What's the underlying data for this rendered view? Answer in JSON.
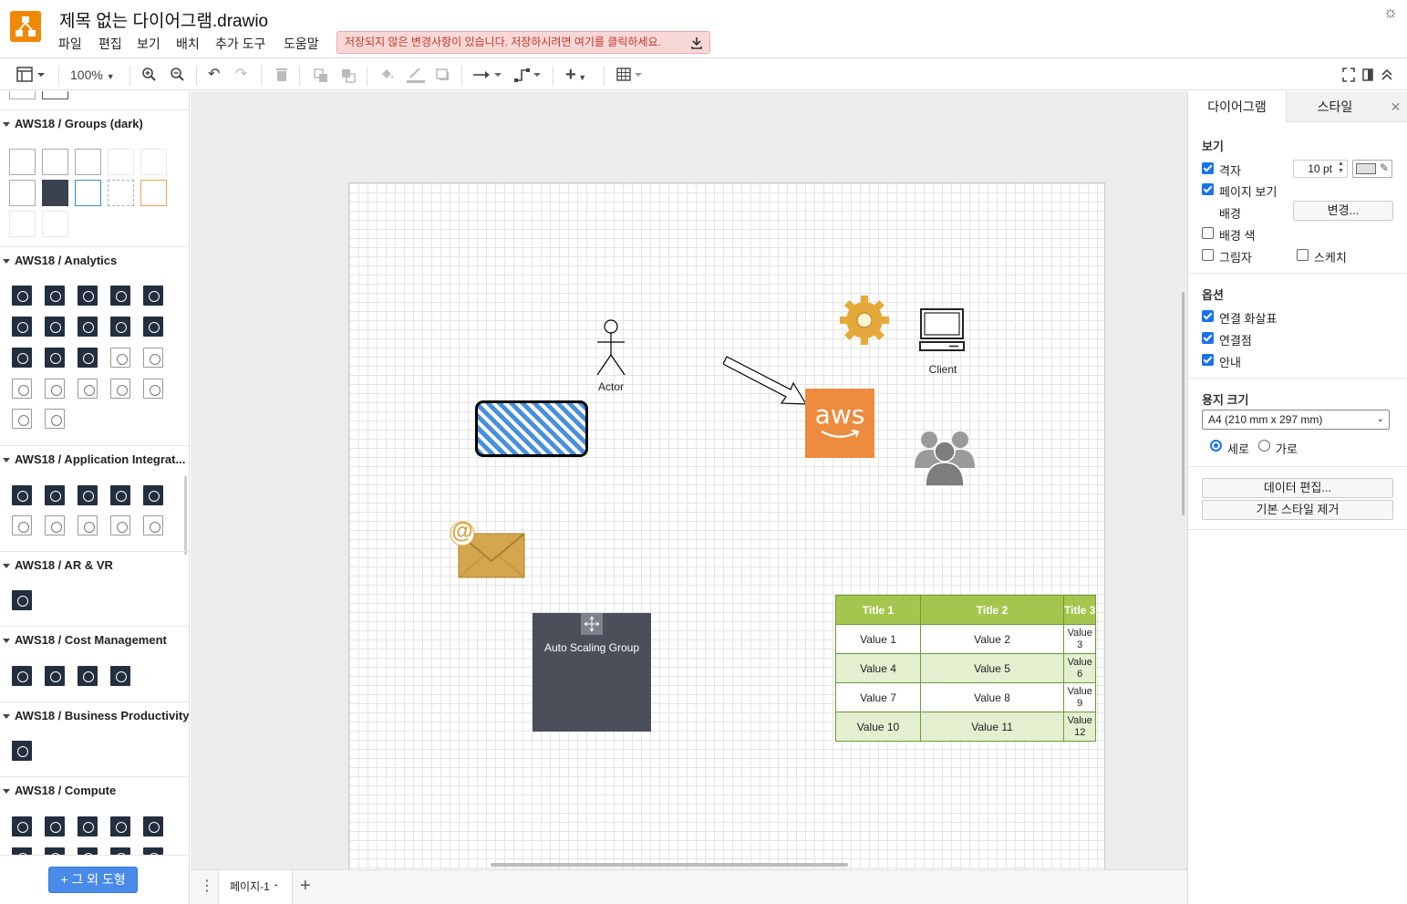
{
  "header": {
    "title": "제목 없는 다이어그램.drawio",
    "menu": [
      "파일",
      "편집",
      "보기",
      "배치",
      "추가 도구",
      "도움말"
    ],
    "unsaved_notice": "저장되지 않은 변경사항이 있습니다. 저장하시려면 여기를 클릭하세요."
  },
  "toolbar": {
    "zoom": "100%"
  },
  "sidebar": {
    "sections": [
      "AWS18 / Groups (dark)",
      "AWS18 / Analytics",
      "AWS18 / Application Integrat...",
      "AWS18 / AR & VR",
      "AWS18 / Cost Management",
      "AWS18 / Business Productivity",
      "AWS18 / Compute"
    ],
    "more_shapes": "+ 그 외 도형"
  },
  "canvas": {
    "actor_label": "Actor",
    "client_label": "Client",
    "aws_logo_text": "aws",
    "asg_label": "Auto Scaling Group",
    "table": {
      "headers": [
        "Title 1",
        "Title 2",
        "Title 3"
      ],
      "rows": [
        [
          "Value 1",
          "Value 2",
          "Value 3"
        ],
        [
          "Value 4",
          "Value 5",
          "Value 6"
        ],
        [
          "Value 7",
          "Value 8",
          "Value 9"
        ],
        [
          "Value 10",
          "Value 11",
          "Value 12"
        ]
      ],
      "header_color": "#a5c64e",
      "alt_row_color": "#e4efd0"
    },
    "email_glyph": "@"
  },
  "pages": {
    "current": "페이지-1"
  },
  "format_panel": {
    "tabs": [
      "다이어그램",
      "스타일"
    ],
    "view_section": "보기",
    "grid": {
      "label": "격자",
      "checked": true,
      "size": "10 pt"
    },
    "page_view": {
      "label": "페이지 보기",
      "checked": true
    },
    "background": {
      "label": "배경",
      "button": "변경..."
    },
    "background_color": {
      "label": "배경 색",
      "checked": false
    },
    "shadow": {
      "label": "그림자",
      "checked": false
    },
    "sketch": {
      "label": "스케치",
      "checked": false
    },
    "options_section": "옵션",
    "connection_arrows": {
      "label": "연결 화살표",
      "checked": true
    },
    "connection_points": {
      "label": "연결점",
      "checked": true
    },
    "guides": {
      "label": "안내",
      "checked": true
    },
    "paper_section": "용지 크기",
    "paper_size": "A4 (210 mm x 297 mm)",
    "portrait": {
      "label": "세로",
      "checked": true
    },
    "landscape": {
      "label": "가로",
      "checked": false
    },
    "edit_data": "데이터 편집...",
    "clear_style": "기본 스타일 제거"
  },
  "colors": {
    "brand": "#f08705",
    "accent": "#1a73e8",
    "aws_orange": "#ed8b3f",
    "asg_dark": "#4a4f5a"
  }
}
